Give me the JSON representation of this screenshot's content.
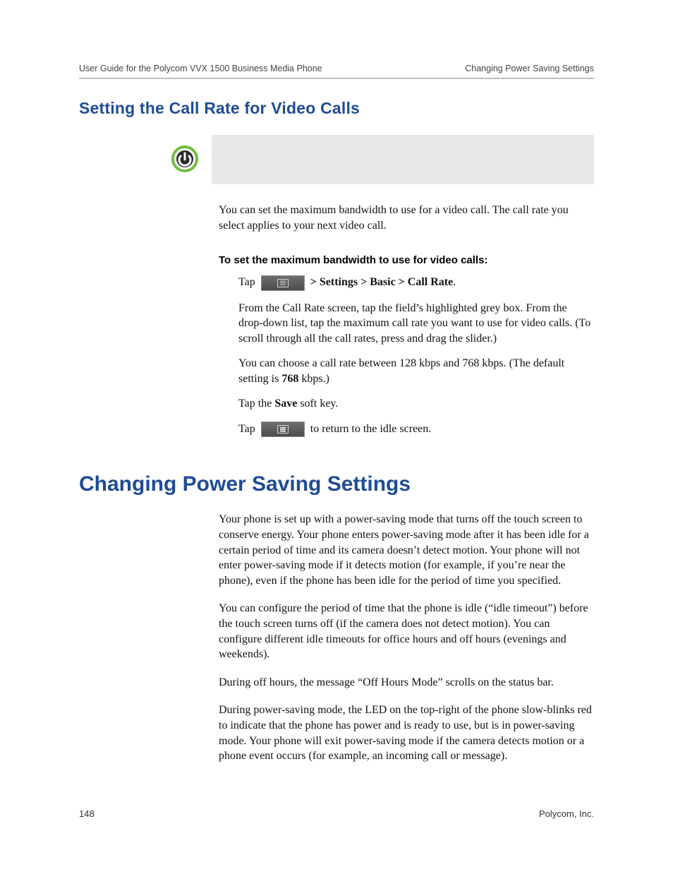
{
  "header": {
    "left": "User Guide for the Polycom VVX 1500 Business Media Phone",
    "right": "Changing Power Saving Settings"
  },
  "section_title": "Setting the Call Rate for Video Calls",
  "intro_para": "You can set the maximum bandwidth to use for a video call. The call rate you select applies to your next video call.",
  "instr_head": "To set the maximum bandwidth to use for video calls:",
  "step1_a": "Tap ",
  "step1_b": " > Settings > Basic > Call Rate",
  "step1_c": ".",
  "step2": "From the Call Rate screen, tap the field’s highlighted grey box. From the drop-down list, tap the maximum call rate you want to use for video calls. (To scroll through all the call rates, press and drag the slider.)",
  "step3_a": "You can choose a call rate between 128 kbps and 768 kbps. (The default setting is ",
  "step3_bold": "768",
  "step3_b": " kbps.)",
  "step4_a": "Tap the ",
  "step4_bold": "Save",
  "step4_b": " soft key.",
  "step5_a": "Tap ",
  "step5_b": " to return to the idle screen.",
  "chapter_title": "Changing Power Saving Settings",
  "chap_p1": "Your phone is set up with a power-saving mode that turns off the touch screen to conserve energy. Your phone enters power-saving mode after it has been idle for a certain period of time and its camera doesn’t detect motion. Your phone will not enter power-saving mode if it detects motion (for example, if you’re near the phone), even if the phone has been idle for the period of time you specified.",
  "chap_p2": "You can configure the period of time that the phone is idle (“idle timeout”) before the touch screen turns off (if the camera does not detect motion). You can configure different idle timeouts for office hours and off hours (evenings and weekends).",
  "chap_p3": "During off hours, the message “Off Hours Mode” scrolls on the status bar.",
  "chap_p4": "During power-saving mode, the LED on the top-right of the phone slow-blinks red to indicate that the phone has power and is ready to use, but is in power-saving mode. Your phone will exit power-saving mode if the camera detects motion or a phone event occurs (for example, an incoming call or message).",
  "footer": {
    "page": "148",
    "company": "Polycom, Inc."
  }
}
